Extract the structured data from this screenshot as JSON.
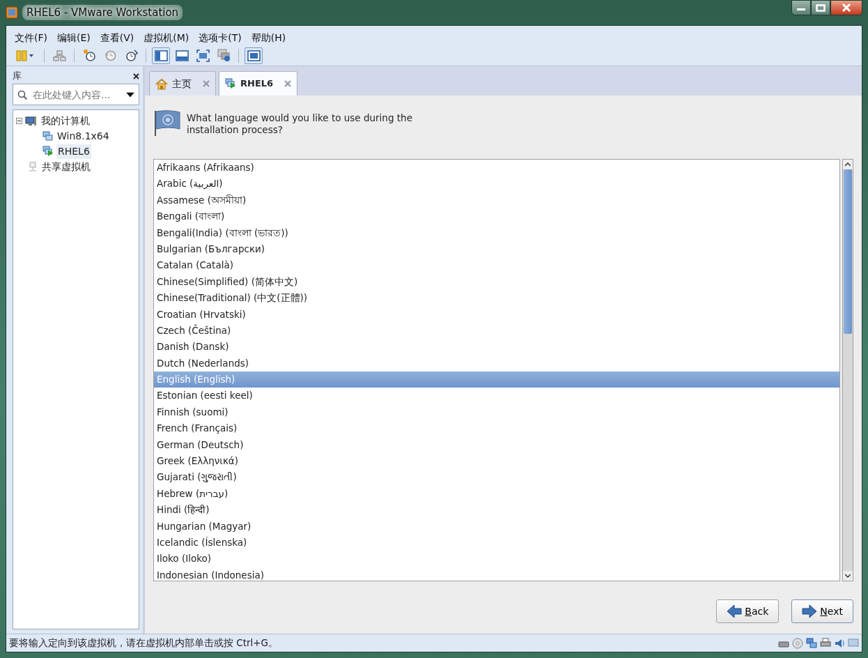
{
  "window": {
    "title": "RHEL6 - VMware Workstation"
  },
  "menu": [
    "文件(F)",
    "编辑(E)",
    "查看(V)",
    "虚拟机(M)",
    "选项卡(T)",
    "帮助(H)"
  ],
  "toolbar": [
    {
      "kind": "pause",
      "selected": false
    },
    {
      "kind": "sep"
    },
    {
      "kind": "network",
      "selected": false
    },
    {
      "kind": "sep"
    },
    {
      "kind": "snapshot",
      "selected": false
    },
    {
      "kind": "revert",
      "selected": false
    },
    {
      "kind": "manager",
      "selected": false
    },
    {
      "kind": "sep"
    },
    {
      "kind": "sidebar",
      "selected": true
    },
    {
      "kind": "thumbs",
      "selected": false
    },
    {
      "kind": "fullscreen",
      "selected": false
    },
    {
      "kind": "unity",
      "selected": false
    },
    {
      "kind": "sep"
    },
    {
      "kind": "console",
      "selected": true
    }
  ],
  "library": {
    "title": "库",
    "search": {
      "placeholder": "在此处键入内容..."
    },
    "tree": [
      {
        "label": "我的计算机",
        "expanded": true,
        "selected": false,
        "children": [
          {
            "label": "Win8.1x64",
            "selected": false
          },
          {
            "label": "RHEL6",
            "selected": true
          }
        ]
      },
      {
        "label": "共享虚拟机",
        "selected": false
      }
    ]
  },
  "tabs": [
    {
      "label": "主页",
      "selected": false
    },
    {
      "label": "RHEL6",
      "selected": true
    }
  ],
  "installer": {
    "question": "What language would you like to use during the installation process?",
    "languages": [
      {
        "label": "Afrikaans (Afrikaans)",
        "selected": false
      },
      {
        "label": "Arabic (العربية)",
        "selected": false
      },
      {
        "label": "Assamese (অসমীয়া)",
        "selected": false
      },
      {
        "label": "Bengali (বাংলা)",
        "selected": false
      },
      {
        "label": "Bengali(India) (বাংলা (ভারত))",
        "selected": false
      },
      {
        "label": "Bulgarian (Български)",
        "selected": false
      },
      {
        "label": "Catalan (Català)",
        "selected": false
      },
      {
        "label": "Chinese(Simplified) (简体中文)",
        "selected": false
      },
      {
        "label": "Chinese(Traditional) (中文(正體))",
        "selected": false
      },
      {
        "label": "Croatian (Hrvatski)",
        "selected": false
      },
      {
        "label": "Czech (Čeština)",
        "selected": false
      },
      {
        "label": "Danish (Dansk)",
        "selected": false
      },
      {
        "label": "Dutch (Nederlands)",
        "selected": false
      },
      {
        "label": "English (English)",
        "selected": true
      },
      {
        "label": "Estonian (eesti keel)",
        "selected": false
      },
      {
        "label": "Finnish (suomi)",
        "selected": false
      },
      {
        "label": "French (Français)",
        "selected": false
      },
      {
        "label": "German (Deutsch)",
        "selected": false
      },
      {
        "label": "Greek (Ελληνικά)",
        "selected": false
      },
      {
        "label": "Gujarati (ગુજરાતી)",
        "selected": false
      },
      {
        "label": "Hebrew (עברית)",
        "selected": false
      },
      {
        "label": "Hindi (हिन्दी)",
        "selected": false
      },
      {
        "label": "Hungarian (Magyar)",
        "selected": false
      },
      {
        "label": "Icelandic (Íslenska)",
        "selected": false
      },
      {
        "label": "Iloko (Iloko)",
        "selected": false
      },
      {
        "label": "Indonesian (Indonesia)",
        "selected": false
      }
    ],
    "buttons": [
      {
        "label": "Back",
        "kind": "back"
      },
      {
        "label": "Next",
        "kind": "next"
      }
    ]
  },
  "status_bar": {
    "text": "要将输入定向到该虚拟机，请在虚拟机内部单击或按 Ctrl+G。"
  }
}
